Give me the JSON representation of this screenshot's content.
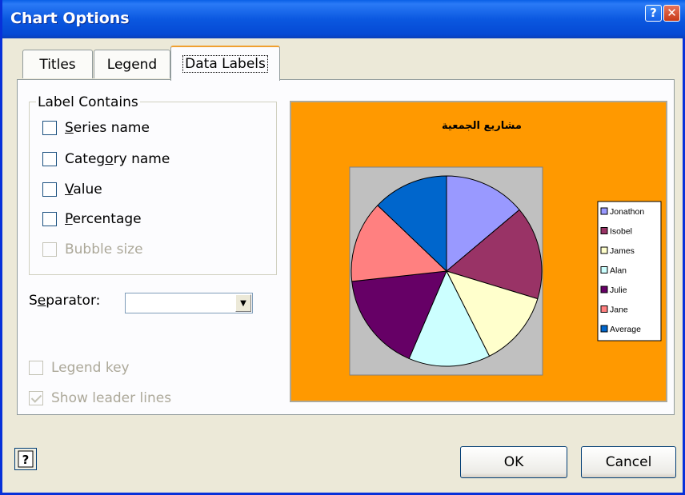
{
  "window": {
    "title": "Chart Options",
    "help_glyph": "?",
    "close_glyph": "✕"
  },
  "tabs": [
    {
      "label": "Titles"
    },
    {
      "label": "Legend"
    },
    {
      "label": "Data Labels"
    }
  ],
  "label_contains": {
    "title": "Label Contains",
    "options": [
      {
        "pre": "",
        "u": "S",
        "post": "eries name",
        "checked": false,
        "enabled": true
      },
      {
        "pre": "Categ",
        "u": "o",
        "post": "ry name",
        "checked": false,
        "enabled": true
      },
      {
        "pre": "",
        "u": "V",
        "post": "alue",
        "checked": false,
        "enabled": true
      },
      {
        "pre": "",
        "u": "P",
        "post": "ercentage",
        "checked": false,
        "enabled": true
      },
      {
        "pre": "Bubble size",
        "u": "",
        "post": "",
        "checked": false,
        "enabled": false
      }
    ]
  },
  "separator": {
    "pre": "S",
    "u": "e",
    "post": "parator:",
    "value": ""
  },
  "legend_key": {
    "label": "Legend key",
    "checked": false,
    "enabled": false
  },
  "leader_lines": {
    "label": "Show leader lines",
    "checked": true,
    "enabled": false
  },
  "chart_data": {
    "type": "pie",
    "title": "مشاريع الجمعية",
    "legend_position": "right",
    "background": "#ff9900",
    "categories": [
      "Jonathon",
      "Isobel",
      "James",
      "Alan",
      "Julie",
      "Jane",
      "Average"
    ],
    "values": [
      14,
      16,
      13,
      14,
      17,
      14,
      13
    ],
    "colors": [
      "#9999ff",
      "#993366",
      "#ffffcc",
      "#ccffff",
      "#660066",
      "#ff8080",
      "#0066cc"
    ]
  },
  "buttons": {
    "ok": "OK",
    "cancel": "Cancel",
    "help_glyph": "?"
  }
}
